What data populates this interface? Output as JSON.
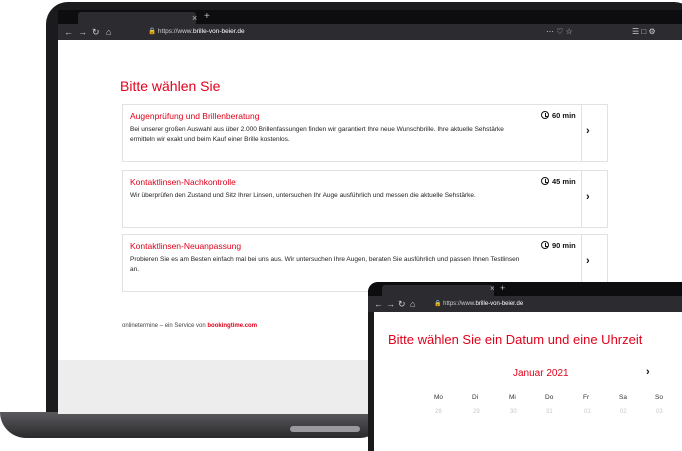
{
  "main_window": {
    "tab": {
      "close_glyph": "×",
      "new_tab_glyph": "+"
    },
    "url": {
      "prefix": "https://www.",
      "host": "brille-von-beier.de"
    },
    "nav_icons": [
      "back-icon",
      "forward-icon",
      "reload-icon",
      "home-icon"
    ],
    "page_title": "Bitte wählen Sie",
    "services": [
      {
        "name": "Augenprüfung und Brillenberatung",
        "description": "Bei unserer großen Auswahl aus über 2.000 Brillenfassungen finden wir garantiert Ihre neue Wunschbrille. Ihre aktuelle Sehstärke ermitteln wir exakt und beim Kauf einer Brille kostenlos.",
        "duration": "60 min"
      },
      {
        "name": "Kontaktlinsen-Nachkontrolle",
        "description": "Wir überprüfen den Zustand und Sitz Ihrer Linsen, untersuchen Ihr Auge ausführlich und messen die aktuelle Sehstärke.",
        "duration": "45 min"
      },
      {
        "name": "Kontaktlinsen-Neuanpassung",
        "description": "Probieren Sie es am Besten einfach mal bei uns aus. Wir untersuchen Ihre Augen, beraten Sie ausführlich und passen Ihnen Testlinsen an.",
        "duration": "90 min"
      }
    ],
    "arrow_glyph": "›",
    "footer": {
      "text": "onlinetermine – ein Service von ",
      "brand": "bookingtime.com"
    }
  },
  "second_window": {
    "tab": {
      "close_glyph": "×",
      "new_tab_glyph": "+"
    },
    "url": {
      "prefix": "https://www.",
      "host": "brille-von-beier.de"
    },
    "page_title": "Bitte wählen Sie ein Datum und eine Uhrzeit",
    "month": "Januar 2021",
    "next_glyph": "›",
    "weekdays": [
      "Mo",
      "Di",
      "Mi",
      "Do",
      "Fr",
      "Sa",
      "So"
    ],
    "days": [
      "28",
      "29",
      "30",
      "31",
      "01",
      "02",
      "03"
    ]
  },
  "colors": {
    "accent": "#e2001a",
    "chrome": "#2c2c30",
    "frame": "#1b1b1d"
  }
}
